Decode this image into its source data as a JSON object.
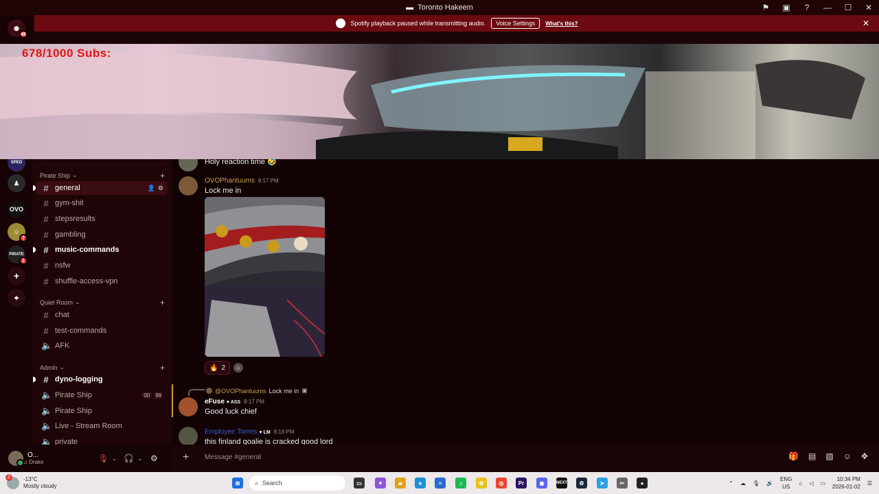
{
  "window": {
    "title": "Toronto Hakeem",
    "controls": [
      "flag-icon",
      "inbox-icon",
      "help-icon",
      "minimize-icon",
      "maximize-icon",
      "close-icon"
    ]
  },
  "notice": {
    "text": "Spotify playback paused while transmitting audio.",
    "button": "Voice Settings",
    "link": "What's this?"
  },
  "rail": {
    "home_badge": "46",
    "server_badges": [
      "7",
      "1"
    ]
  },
  "overlay": {
    "subs_text": "678/1000  Subs:"
  },
  "sidebar": {
    "categories": [
      {
        "label": "Pirate Ship",
        "channels": [
          {
            "name": "general",
            "type": "text",
            "state": "active"
          },
          {
            "name": "gym-shit",
            "type": "text",
            "state": "normal"
          },
          {
            "name": "stepsresults",
            "type": "text",
            "state": "normal"
          },
          {
            "name": "gambling",
            "type": "text",
            "state": "normal"
          },
          {
            "name": "music-commands",
            "type": "text",
            "state": "unread"
          },
          {
            "name": "nsfw",
            "type": "text",
            "state": "normal"
          },
          {
            "name": "shuffle-access-vpn",
            "type": "text",
            "state": "normal"
          }
        ]
      },
      {
        "label": "Quiet Room",
        "channels": [
          {
            "name": "chat",
            "type": "text",
            "state": "normal"
          },
          {
            "name": "test-commands",
            "type": "text",
            "state": "normal"
          },
          {
            "name": "AFK",
            "type": "voice",
            "state": "normal"
          }
        ]
      },
      {
        "label": "Admin",
        "channels": [
          {
            "name": "dyno-logging",
            "type": "text",
            "state": "unread"
          },
          {
            "name": "Pirate Ship",
            "type": "voice",
            "state": "normal",
            "counts": [
              "00",
              "99"
            ]
          },
          {
            "name": "Pirate Ship",
            "type": "voice",
            "state": "normal"
          },
          {
            "name": "Live - Stream Room",
            "type": "voice",
            "state": "normal"
          },
          {
            "name": "private",
            "type": "voice",
            "state": "normal"
          }
        ]
      }
    ]
  },
  "user": {
    "name": "O...",
    "status": "Drake"
  },
  "messages": [
    {
      "text": "Holy reaction time 🤣"
    },
    {
      "author": "OVOPhantuums",
      "author_color": "#c8a24a",
      "time": "8:17 PM",
      "text": "Lock me in",
      "reaction": {
        "emoji": "🔥",
        "count": "2"
      }
    },
    {
      "reply_to": "@OVOPhantuums",
      "reply_text": "Lock me in",
      "author": "eFuse",
      "author_color": "#ffffff",
      "tag": "ASS",
      "time": "8:17 PM",
      "text": "Good luck chief"
    },
    {
      "author": "Employee Tomes",
      "author_color": "#3b5bdb",
      "tag": "LM",
      "time": "8:18 PM",
      "text": "this finland goalie is cracked good lord"
    }
  ],
  "composer": {
    "placeholder": "Message #general"
  },
  "taskbar": {
    "weather_temp": "-13°C",
    "weather_desc": "Mostly cloudy",
    "weather_badge": "2",
    "search_placeholder": "Search",
    "lang_line1": "ENG",
    "lang_line2": "US",
    "time": "10:34 PM",
    "date": "2026-01-02"
  }
}
